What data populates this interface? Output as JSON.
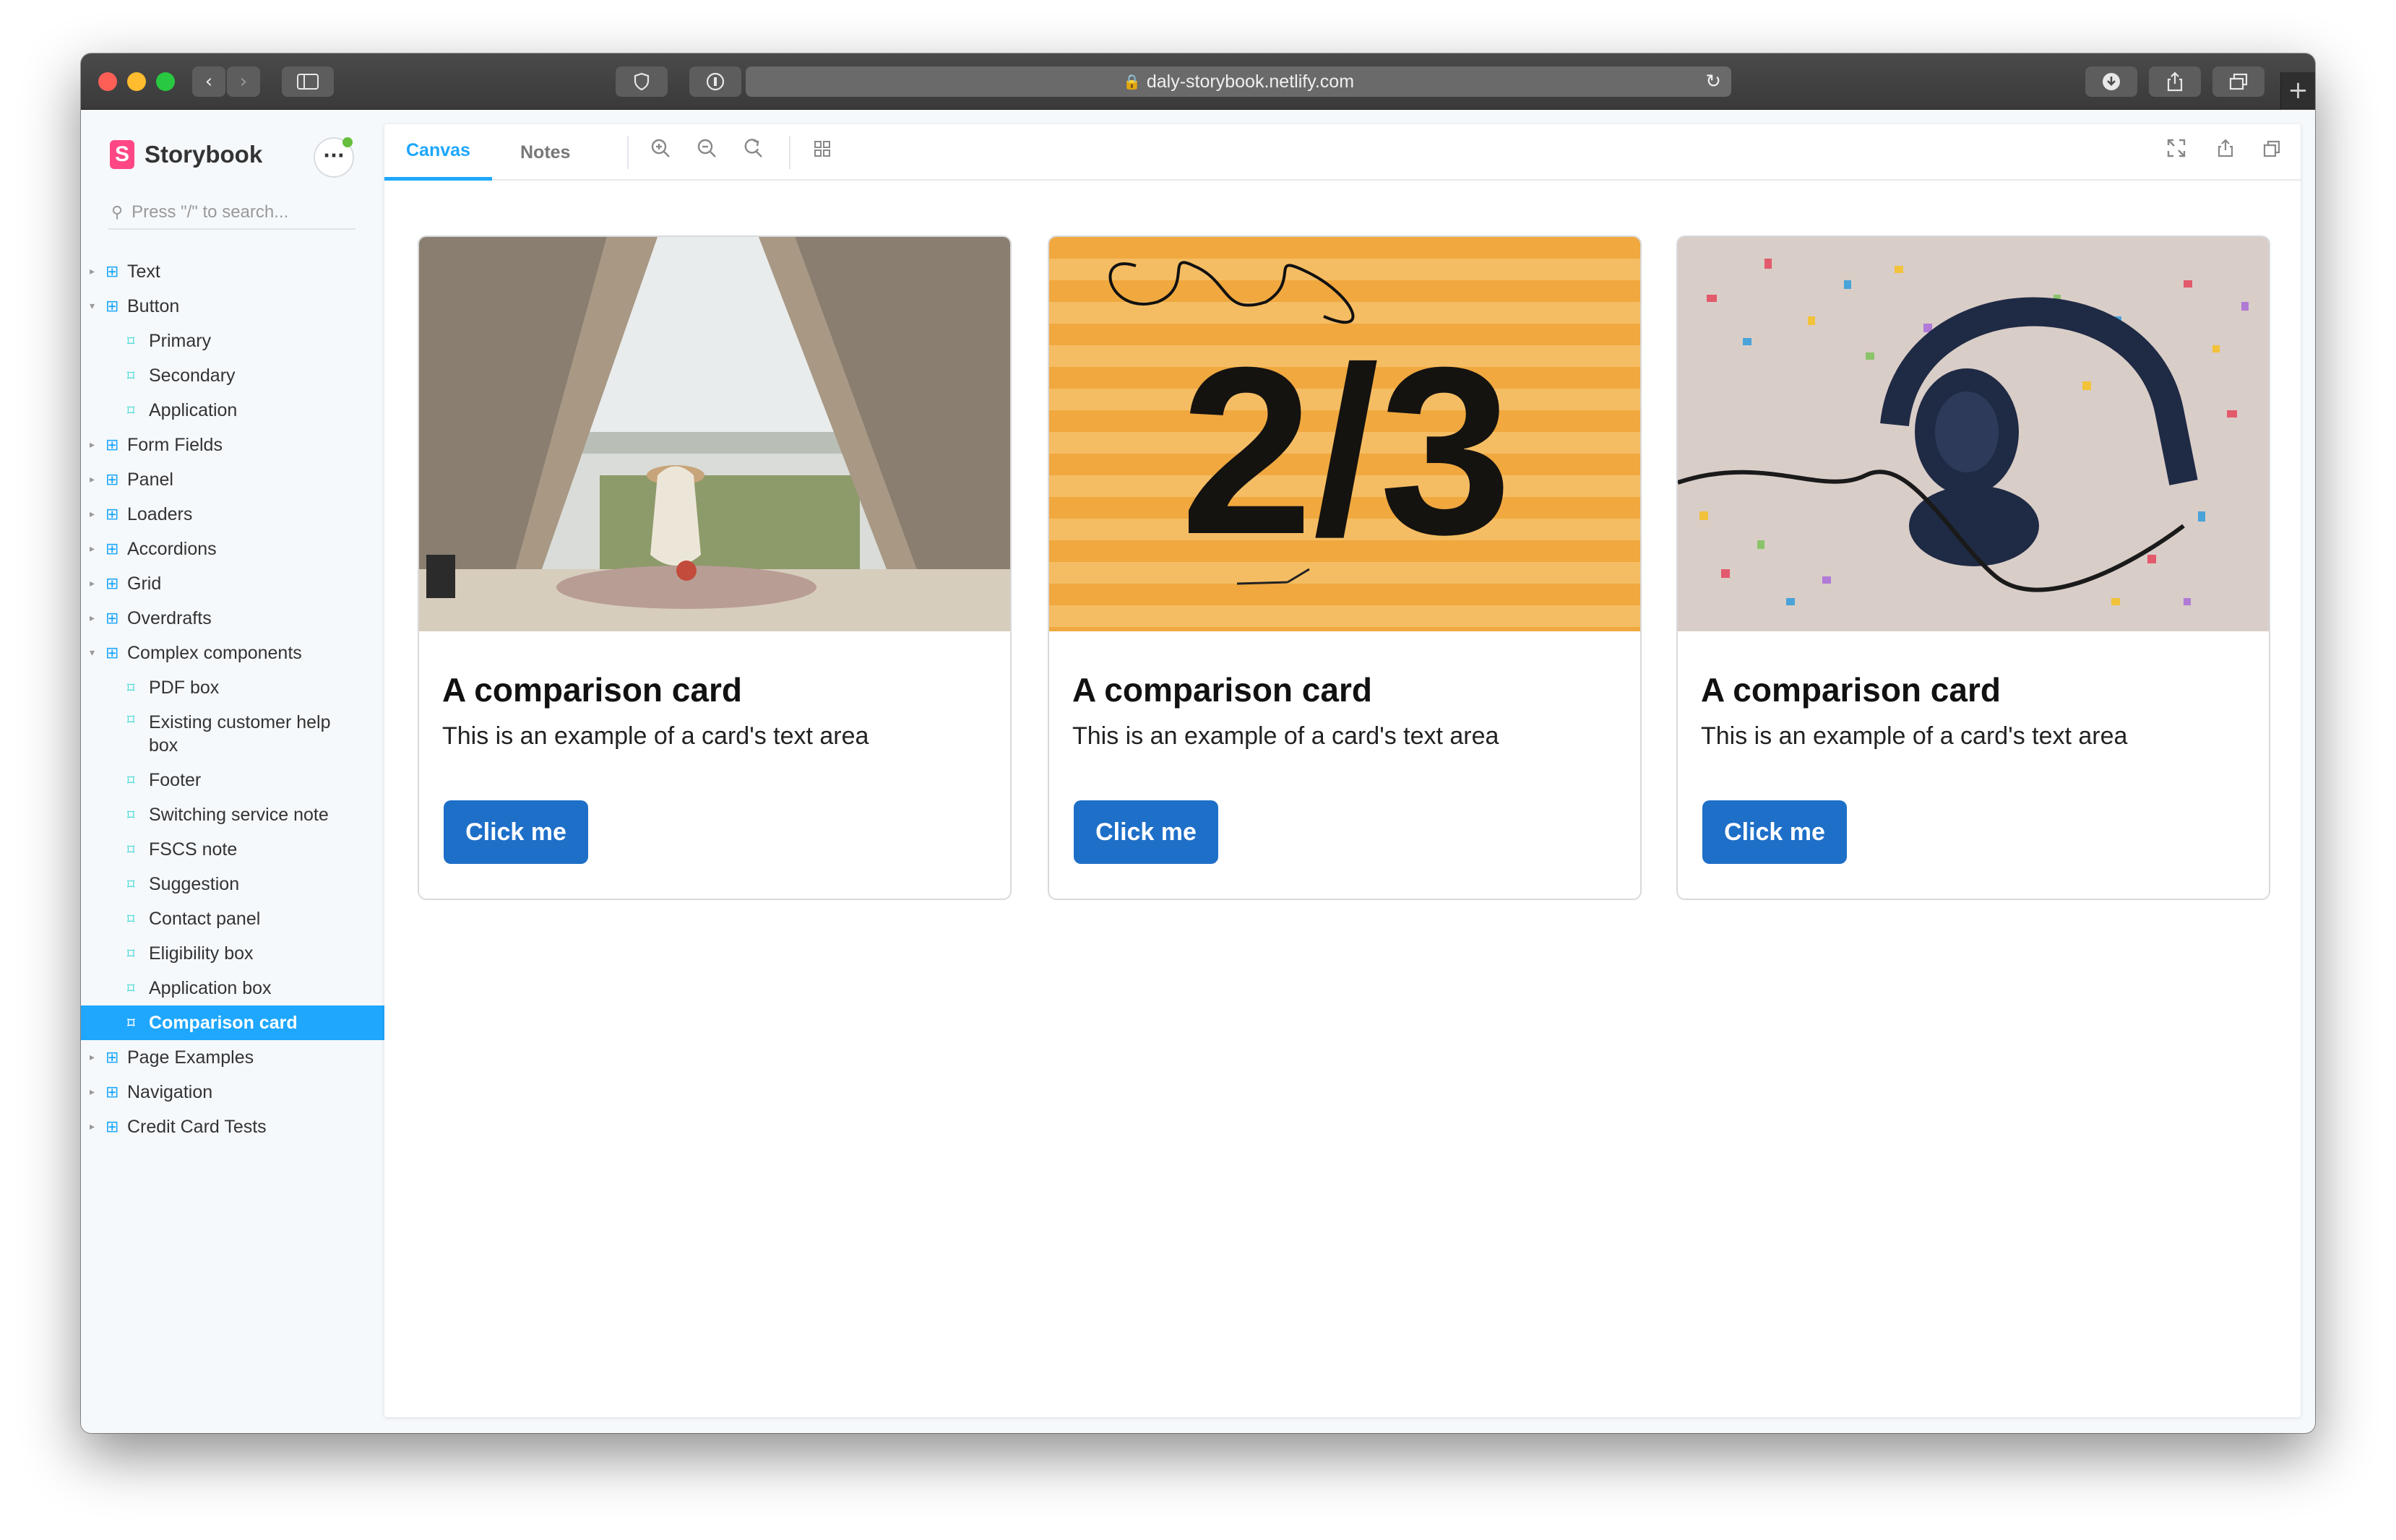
{
  "browser": {
    "url": "daly-storybook.netlify.com"
  },
  "sidebar": {
    "logo_text": "Storybook",
    "search_placeholder": "Press \"/\" to search...",
    "items": [
      {
        "label": "Text",
        "type": "group",
        "expanded": false
      },
      {
        "label": "Button",
        "type": "group",
        "expanded": true
      },
      {
        "label": "Primary",
        "type": "story"
      },
      {
        "label": "Secondary",
        "type": "story"
      },
      {
        "label": "Application",
        "type": "story"
      },
      {
        "label": "Form Fields",
        "type": "group",
        "expanded": false
      },
      {
        "label": "Panel",
        "type": "group",
        "expanded": false
      },
      {
        "label": "Loaders",
        "type": "group",
        "expanded": false
      },
      {
        "label": "Accordions",
        "type": "group",
        "expanded": false
      },
      {
        "label": "Grid",
        "type": "group",
        "expanded": false
      },
      {
        "label": "Overdrafts",
        "type": "group",
        "expanded": false
      },
      {
        "label": "Complex components",
        "type": "group",
        "expanded": true
      },
      {
        "label": "PDF box",
        "type": "story"
      },
      {
        "label": "Existing customer help box",
        "type": "story"
      },
      {
        "label": "Footer",
        "type": "story"
      },
      {
        "label": "Switching service note",
        "type": "story"
      },
      {
        "label": "FSCS note",
        "type": "story"
      },
      {
        "label": "Suggestion",
        "type": "story"
      },
      {
        "label": "Contact panel",
        "type": "story"
      },
      {
        "label": "Eligibility box",
        "type": "story"
      },
      {
        "label": "Application box",
        "type": "story"
      },
      {
        "label": "Comparison card",
        "type": "story",
        "active": true
      },
      {
        "label": "Page Examples",
        "type": "group",
        "expanded": false
      },
      {
        "label": "Navigation",
        "type": "group",
        "expanded": false
      },
      {
        "label": "Credit Card Tests",
        "type": "group",
        "expanded": false
      }
    ]
  },
  "toolbar": {
    "tabs": [
      "Canvas",
      "Notes"
    ],
    "active_tab": "Canvas"
  },
  "cards": [
    {
      "title": "A comparison card",
      "text": "This is an example of a card's text area",
      "button": "Click me",
      "image": "tent-picnic-lake"
    },
    {
      "title": "A comparison card",
      "text": "This is an example of a card's text area",
      "button": "Click me",
      "image": "orange-2-3-sign"
    },
    {
      "title": "A comparison card",
      "text": "This is an example of a card's text area",
      "button": "Click me",
      "image": "headphones-confetti"
    }
  ],
  "card2_sign_text": "2/3",
  "colors": {
    "accent": "#1ea7fd",
    "button": "#1e6fc8",
    "logo": "#ff4785"
  }
}
